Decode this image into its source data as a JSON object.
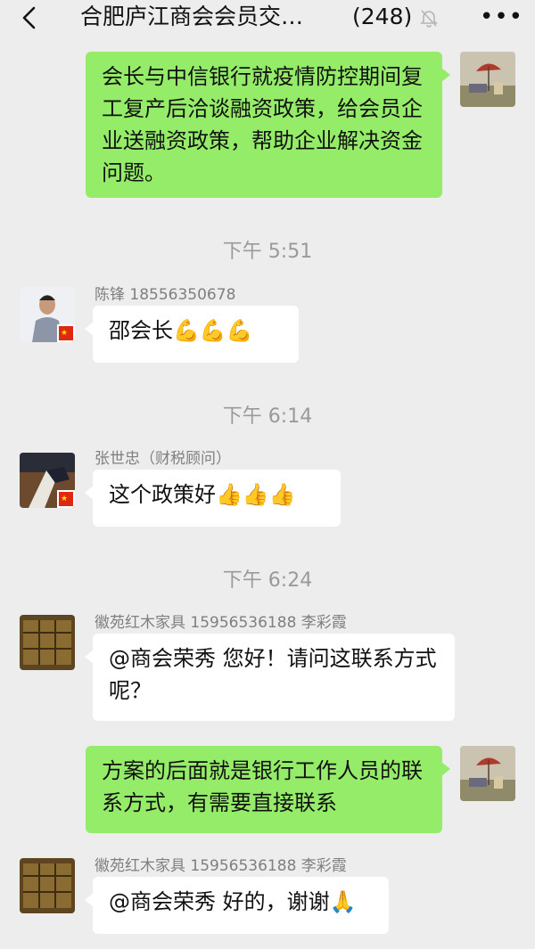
{
  "header": {
    "title": "合肥庐江商会会员交…",
    "count": "(248)",
    "more": "•••"
  },
  "messages": {
    "m1": {
      "text": "会长与中信银行就疫情防控期间复工复产后洽谈融资政策，给会员企业送融资政策，帮助企业解决资金问题。"
    },
    "t1": {
      "time": "下午 5:51"
    },
    "m2": {
      "sender": "陈锋 18556350678",
      "text": "邵会长💪💪💪"
    },
    "t2": {
      "time": "下午 6:14"
    },
    "m3": {
      "sender": "张世忠（财税顾问）",
      "text": "这个政策好👍👍👍"
    },
    "t3": {
      "time": "下午 6:24"
    },
    "m4": {
      "sender": "徽苑红木家具 15956536188 李彩霞",
      "text": "@商会荣秀 您好！请问这联系方式呢？"
    },
    "m5": {
      "text": "方案的后面就是银行工作人员的联系方式，有需要直接联系"
    },
    "m6": {
      "sender": "徽苑红木家具 15956536188 李彩霞",
      "text": "@商会荣秀 好的，谢谢🙏"
    }
  },
  "colors": {
    "sent_bubble": "#95ec69",
    "received_bubble": "#ffffff",
    "background": "#ededed"
  }
}
